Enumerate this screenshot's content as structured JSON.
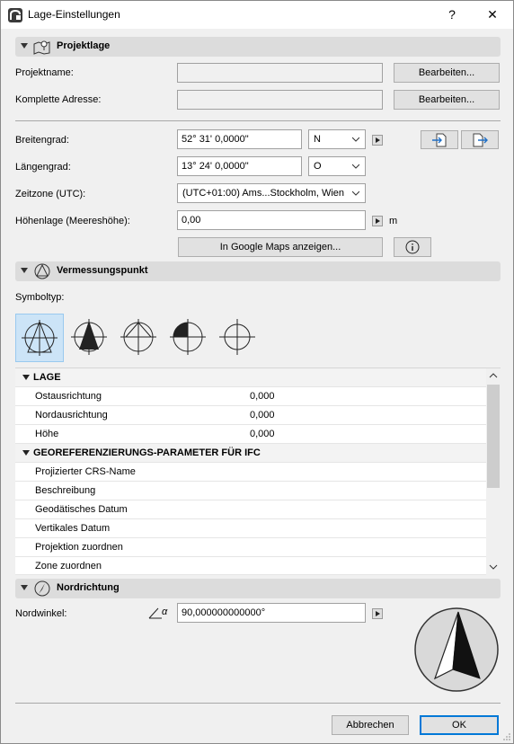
{
  "window": {
    "title": "Lage-Einstellungen",
    "help_label": "?",
    "close_label": "✕"
  },
  "projektlage": {
    "header": "Projektlage",
    "projektname_label": "Projektname:",
    "adresse_label": "Komplette Adresse:",
    "edit_label": "Bearbeiten...",
    "breitengrad_label": "Breitengrad:",
    "breitengrad_value": "52° 31' 0,0000\"",
    "breitengrad_dir": "N",
    "laengengrad_label": "Längengrad:",
    "laengengrad_value": "13° 24' 0,0000\"",
    "laengengrad_dir": "O",
    "zeitzone_label": "Zeitzone (UTC):",
    "zeitzone_value": "(UTC+01:00) Ams...Stockholm, Wien",
    "hoehe_label": "Höhenlage (Meereshöhe):",
    "hoehe_value": "0,00",
    "hoehe_unit": "m",
    "maps_button": "In Google Maps anzeigen..."
  },
  "vermessungspunkt": {
    "header": "Vermessungspunkt",
    "symboltyp_label": "Symboltyp:"
  },
  "table": {
    "groups": [
      {
        "title": "LAGE",
        "rows": [
          {
            "key": "Ostausrichtung",
            "value": "0,000"
          },
          {
            "key": "Nordausrichtung",
            "value": "0,000"
          },
          {
            "key": "Höhe",
            "value": "0,000"
          }
        ]
      },
      {
        "title": "GEOREFERENZIERUNGS-PARAMETER FÜR IFC",
        "rows": [
          {
            "key": "Projizierter CRS-Name",
            "value": ""
          },
          {
            "key": "Beschreibung",
            "value": ""
          },
          {
            "key": "Geodätisches Datum",
            "value": ""
          },
          {
            "key": "Vertikales Datum",
            "value": ""
          },
          {
            "key": "Projektion zuordnen",
            "value": ""
          },
          {
            "key": "Zone zuordnen",
            "value": ""
          }
        ]
      }
    ]
  },
  "nordrichtung": {
    "header": "Nordrichtung",
    "nordwinkel_label": "Nordwinkel:",
    "nordwinkel_value": "90,000000000000°",
    "angle_symbol": "α"
  },
  "footer": {
    "cancel_label": "Abbrechen",
    "ok_label": "OK"
  },
  "colors": {
    "accent": "#0078d7",
    "selected_bg": "#cce4f7",
    "section_bg": "#dcdcdc"
  }
}
